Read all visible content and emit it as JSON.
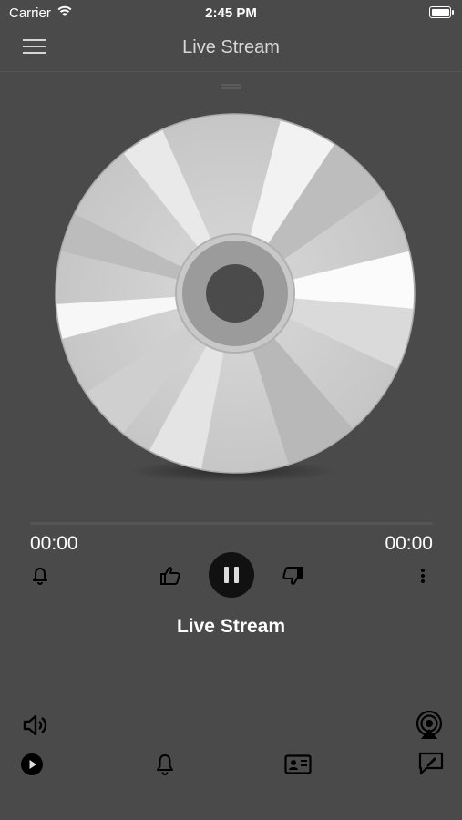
{
  "status_bar": {
    "carrier": "Carrier",
    "time": "2:45 PM",
    "battery_level": 1.0
  },
  "nav": {
    "title": "Live Stream",
    "menu_icon": "hamburger-menu-icon"
  },
  "player": {
    "artwork_icon": "cd-disc",
    "elapsed": "00:00",
    "duration": "00:00",
    "progress": 0,
    "track_title": "Live Stream",
    "controls": [
      "bell-icon",
      "thumbs-up-icon",
      "pause-icon",
      "thumbs-down-icon",
      "more-vertical-icon"
    ]
  },
  "bottom_bar": {
    "icons": [
      "volume-icon",
      "airplay-icon",
      "play-circle-icon",
      "bell-icon",
      "contact-card-icon",
      "chat-edit-icon"
    ]
  },
  "colors": {
    "background": "#4a4a4a",
    "pause_button": "#111111",
    "text": "#ffffff"
  }
}
